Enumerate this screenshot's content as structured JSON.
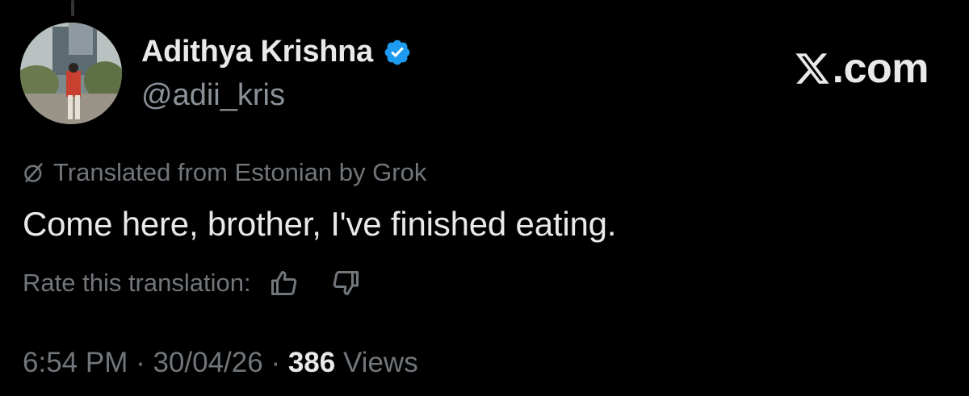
{
  "author": {
    "display_name": "Adithya Krishna",
    "handle": "@adii_kris",
    "verified": true,
    "avatar_icon": "profile-photo-avatar"
  },
  "brand": {
    "label": ".com",
    "icon": "x-logo-icon"
  },
  "translation": {
    "notice": "Translated from Estonian by Grok",
    "icon": "grok-icon",
    "rate_label": "Rate this translation:"
  },
  "tweet": {
    "text": "Come here, brother, I've finished eating."
  },
  "meta": {
    "time": "6:54 PM",
    "separator": " · ",
    "date": "30/04/26",
    "views_count": "386",
    "views_label": "Views"
  },
  "colors": {
    "background": "#000000",
    "primary_text": "#e7e9ea",
    "secondary_text": "#71767b",
    "verified_badge": "#1d9bf0"
  }
}
